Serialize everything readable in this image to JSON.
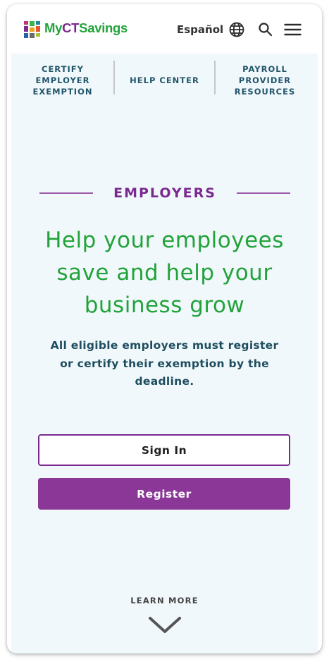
{
  "header": {
    "brand_prefix": "My",
    "brand_ct": "CT",
    "brand_suffix": "Savings",
    "language_label": "Español",
    "icons": [
      "brand-logo-icon",
      "globe-icon",
      "search-icon",
      "hamburger-menu-icon"
    ],
    "colors": {
      "brand_green": "#22a33a",
      "brand_purple": "#7a2a8e",
      "logo_colors": [
        "#c8326b",
        "#3bb54a",
        "#1b8c9c",
        "#7a2a8e",
        "#f2a21a",
        "#e5552f",
        "#2b5fa6",
        "#6c6c6c",
        "#a2c639"
      ]
    }
  },
  "subnav": {
    "items": [
      {
        "label": "CERTIFY\nEMPLOYER\nEXEMPTION"
      },
      {
        "label": "HELP CENTER"
      },
      {
        "label": "PAYROLL\nPROVIDER\nRESOURCES"
      }
    ]
  },
  "hero": {
    "eyebrow": "EMPLOYERS",
    "headline": "Help your employees save and help your business grow",
    "subtext": "All eligible employers must register or certify their exemption by the deadline.",
    "sign_in_label": "Sign In",
    "register_label": "Register",
    "learn_more_label": "LEARN MORE",
    "colors": {
      "eyebrow": "#7a2a8e",
      "headline": "#22a33a",
      "register_bg": "#8a3797",
      "background": "#f1f8fc"
    }
  }
}
